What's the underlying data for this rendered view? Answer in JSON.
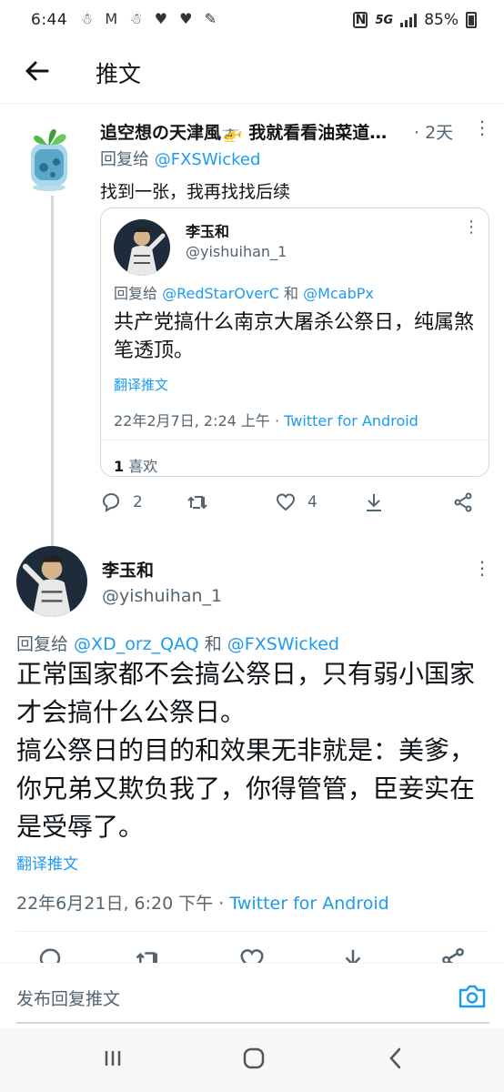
{
  "status": {
    "time": "6:44",
    "notif_icons": "☃ M ☃ ♥ ♥ ✎",
    "network": "5G",
    "battery": "85%"
  },
  "header": {
    "title": "推文"
  },
  "reply_tweet": {
    "display_name": "追空想の天津風🚁 我就看看油菜道…",
    "age": "· 2天",
    "reply_prefix": "回复给 ",
    "reply_handle": "@FXSWicked",
    "text": "找到一张，我再找找后续",
    "quote": {
      "display_name": "李玉和",
      "handle": "@yishuihan_1",
      "reply_prefix": "回复给 ",
      "reply_handle_1": "@RedStarOverC",
      "reply_joiner": " 和 ",
      "reply_handle_2": "@McabPx",
      "text": "共产党搞什么南京大屠杀公祭日，纯属煞笔透顶。",
      "translate": "翻译推文",
      "time": "22年2月7日, 2:24 上午 · ",
      "source": "Twitter for Android",
      "like_count": "1",
      "like_label": " 喜欢"
    },
    "actions": {
      "replies": "2",
      "likes": "4"
    }
  },
  "main_tweet": {
    "display_name": "李玉和",
    "handle": "@yishuihan_1",
    "reply_prefix": "回复给 ",
    "reply_handle_1": "@XD_orz_QAQ",
    "reply_joiner": " 和 ",
    "reply_handle_2": "@FXSWicked",
    "text": "正常国家都不会搞公祭日，只有弱小国家才会搞什么公祭日。\n搞公祭日的目的和效果无非就是：美爹，你兄弟又欺负我了，你得管管，臣妾实在是受辱了。",
    "translate": "翻译推文",
    "time": "22年6月21日, 6:20 下午 · ",
    "source": "Twitter for Android"
  },
  "compose": {
    "placeholder": "发布回复推文"
  },
  "colors": {
    "accent": "#1d9bf0",
    "muted": "#536471",
    "text": "#0f1419"
  }
}
